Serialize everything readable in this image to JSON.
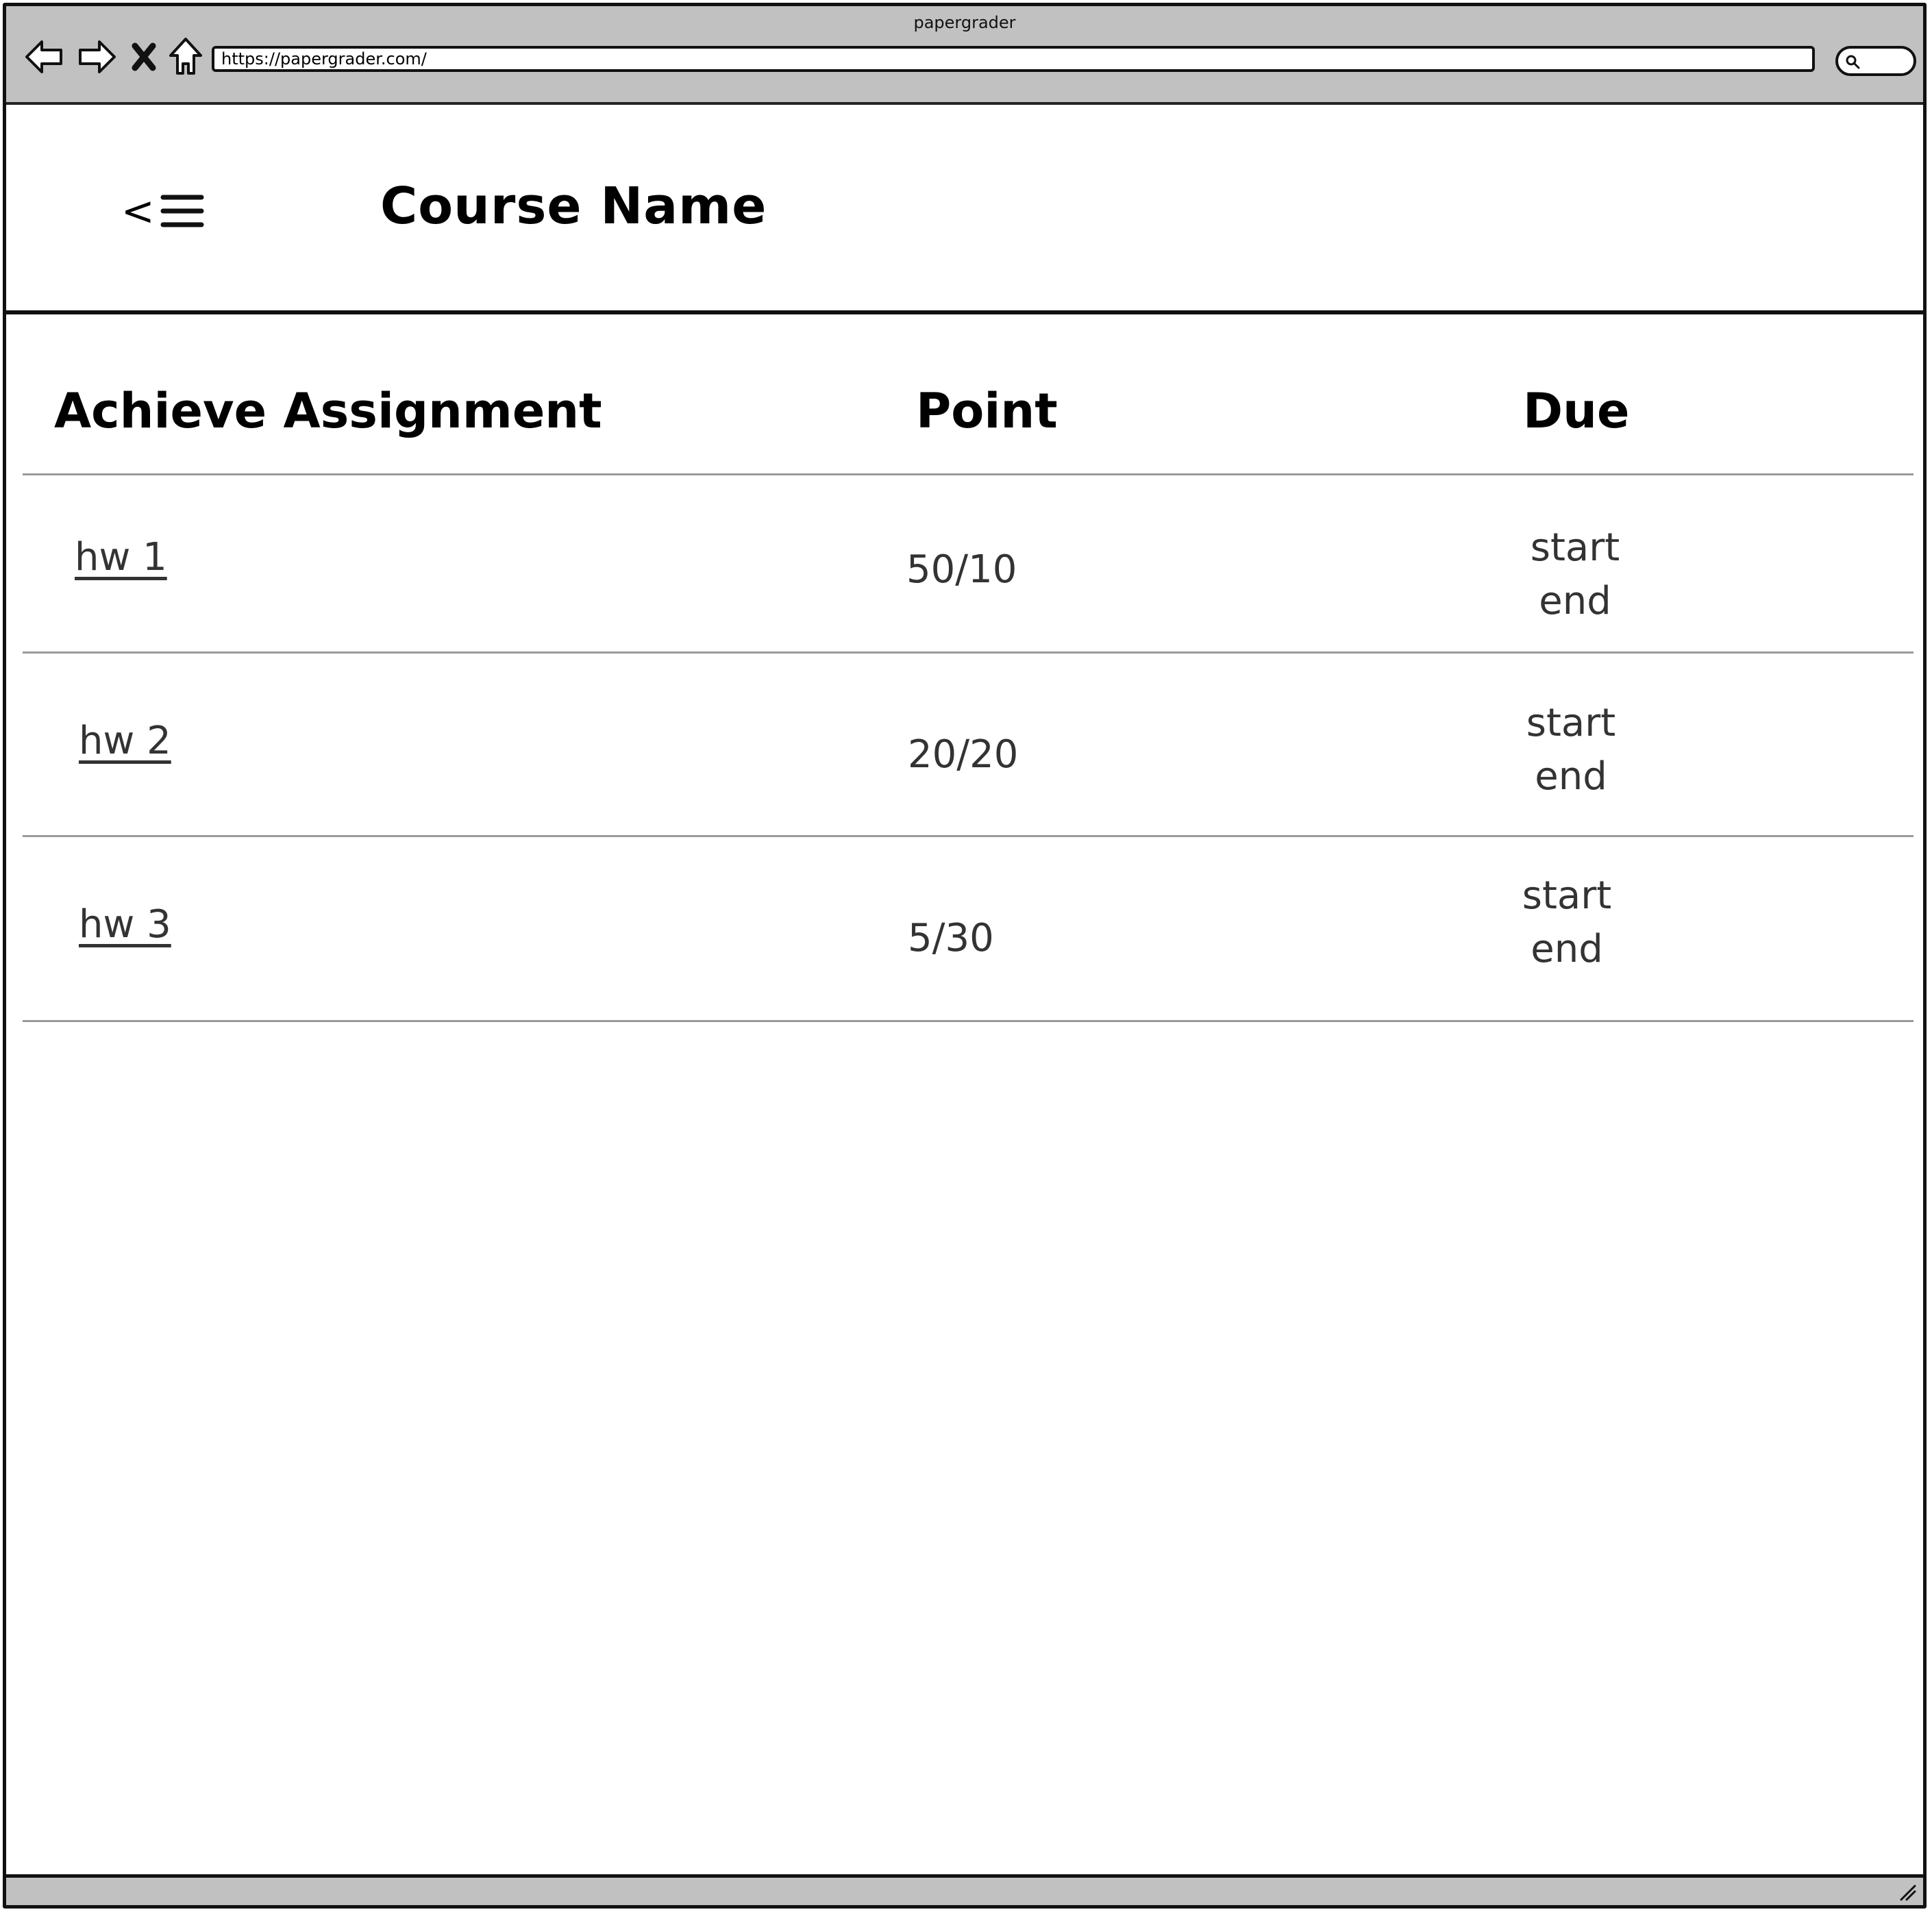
{
  "browser": {
    "title": "papergrader",
    "url": "https://papergrader.com/"
  },
  "header": {
    "menu_label": "<",
    "course_name": "Course Name"
  },
  "table": {
    "columns": [
      "Achieve Assignment",
      "Point",
      "Due"
    ],
    "rows": [
      {
        "name": "hw 1",
        "points": "50/10",
        "due_start": "start",
        "due_end": "end"
      },
      {
        "name": "hw 2",
        "points": "20/20",
        "due_start": "start",
        "due_end": "end"
      },
      {
        "name": "hw 3",
        "points": "5/30",
        "due_start": "start",
        "due_end": "end"
      }
    ]
  },
  "icons": [
    "back-arrow-icon",
    "forward-arrow-icon",
    "stop-icon",
    "home-icon",
    "search-icon",
    "hamburger-menu-icon",
    "resize-grip-icon"
  ]
}
